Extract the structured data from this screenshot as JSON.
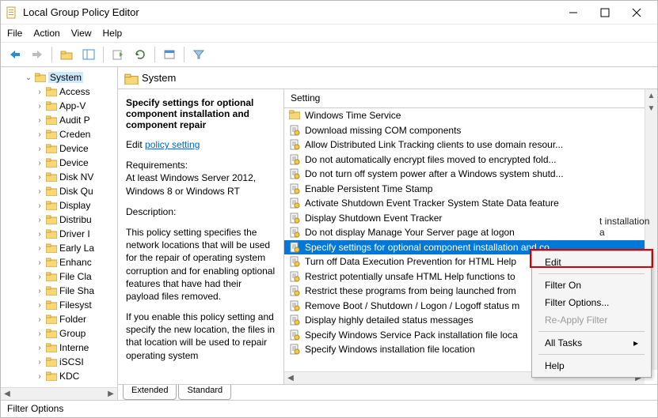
{
  "title": "Local Group Policy Editor",
  "menubar": [
    "File",
    "Action",
    "View",
    "Help"
  ],
  "tree": {
    "parent": "System",
    "children": [
      "Access",
      "App-V",
      "Audit P",
      "Creden",
      "Device",
      "Device",
      "Disk NV",
      "Disk Qu",
      "Display",
      "Distribu",
      "Driver I",
      "Early La",
      "Enhanc",
      "File Cla",
      "File Sha",
      "Filesyst",
      "Folder",
      "Group",
      "Interne",
      "iSCSI",
      "KDC"
    ]
  },
  "header": {
    "title": "System"
  },
  "desc": {
    "title": "Specify settings for optional component installation and component repair",
    "edit_prefix": "Edit",
    "edit_link": "policy setting",
    "req_label": "Requirements:",
    "req_text": "At least Windows Server 2012, Windows 8 or Windows RT",
    "d_label": "Description:",
    "d_text1": "This policy setting specifies the network locations that will be used for the repair of operating system corruption and for enabling optional features that have had their payload files removed.",
    "d_text2": "If you enable this policy setting and specify the new location, the files in that location will be used to repair operating system"
  },
  "list_header": "Setting",
  "settings": [
    {
      "type": "folder",
      "label": "Windows Time Service"
    },
    {
      "type": "item",
      "label": "Download missing COM components"
    },
    {
      "type": "item",
      "label": "Allow Distributed Link Tracking clients to use domain resour..."
    },
    {
      "type": "item",
      "label": "Do not automatically encrypt files moved to encrypted fold..."
    },
    {
      "type": "item",
      "label": "Do not turn off system power after a Windows system shutd..."
    },
    {
      "type": "item",
      "label": "Enable Persistent Time Stamp"
    },
    {
      "type": "item",
      "label": "Activate Shutdown Event Tracker System State Data feature"
    },
    {
      "type": "item",
      "label": "Display Shutdown Event Tracker"
    },
    {
      "type": "item",
      "label": "Do not display Manage Your Server page at logon"
    },
    {
      "type": "item",
      "label": "Specify settings for optional component installation and co...",
      "selected": true
    },
    {
      "type": "item",
      "label": "Turn off Data Execution Prevention for HTML Help"
    },
    {
      "type": "item",
      "label": "Restrict potentially unsafe HTML Help functions to"
    },
    {
      "type": "item",
      "label": "Restrict these programs from being launched from"
    },
    {
      "type": "item",
      "label": "Remove Boot / Shutdown / Logon / Logoff status m"
    },
    {
      "type": "item",
      "label": "Display highly detailed status messages"
    },
    {
      "type": "item",
      "label": "Specify Windows Service Pack installation file loca"
    },
    {
      "type": "item",
      "label": "Specify Windows installation file location"
    }
  ],
  "tabs": {
    "extended": "Extended",
    "standard": "Standard"
  },
  "status": "Filter Options",
  "ctx": {
    "edit": "Edit",
    "filter_on": "Filter On",
    "filter_options": "Filter Options...",
    "reapply": "Re-Apply Filter",
    "all_tasks": "All Tasks",
    "help": "Help"
  },
  "bg_text": "t installation a"
}
